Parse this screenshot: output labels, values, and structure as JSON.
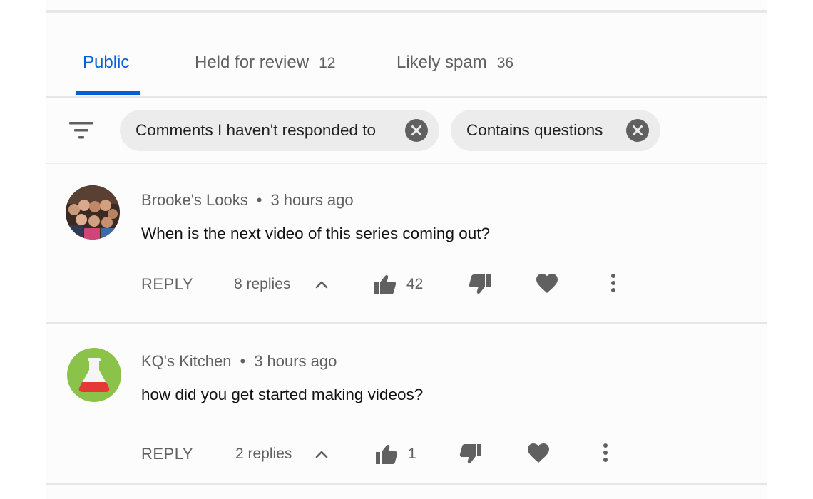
{
  "tabs": [
    {
      "label": "Public",
      "count": ""
    },
    {
      "label": "Held for review",
      "count": "12"
    },
    {
      "label": "Likely spam",
      "count": "36"
    }
  ],
  "filters": {
    "chips": [
      "Comments I haven't responded to",
      "Contains questions"
    ]
  },
  "comments": [
    {
      "author": "Brooke's Looks",
      "separator": "•",
      "time": "3 hours ago",
      "text": "When is the next video of this series coming out?",
      "reply_label": "REPLY",
      "replies": "8 replies",
      "likes": "42",
      "avatar": "group-photo"
    },
    {
      "author": "KQ's Kitchen",
      "separator": "•",
      "time": "3 hours ago",
      "text": "how did you get started making videos?",
      "reply_label": "REPLY",
      "replies": "2 replies",
      "likes": "1",
      "avatar": "flask-icon"
    }
  ],
  "colors": {
    "accent": "#065fd4",
    "chip_bg": "#ececec",
    "icon_gray": "#606060",
    "kitchen_green": "#8bc34a",
    "flask_red": "#e53935"
  }
}
